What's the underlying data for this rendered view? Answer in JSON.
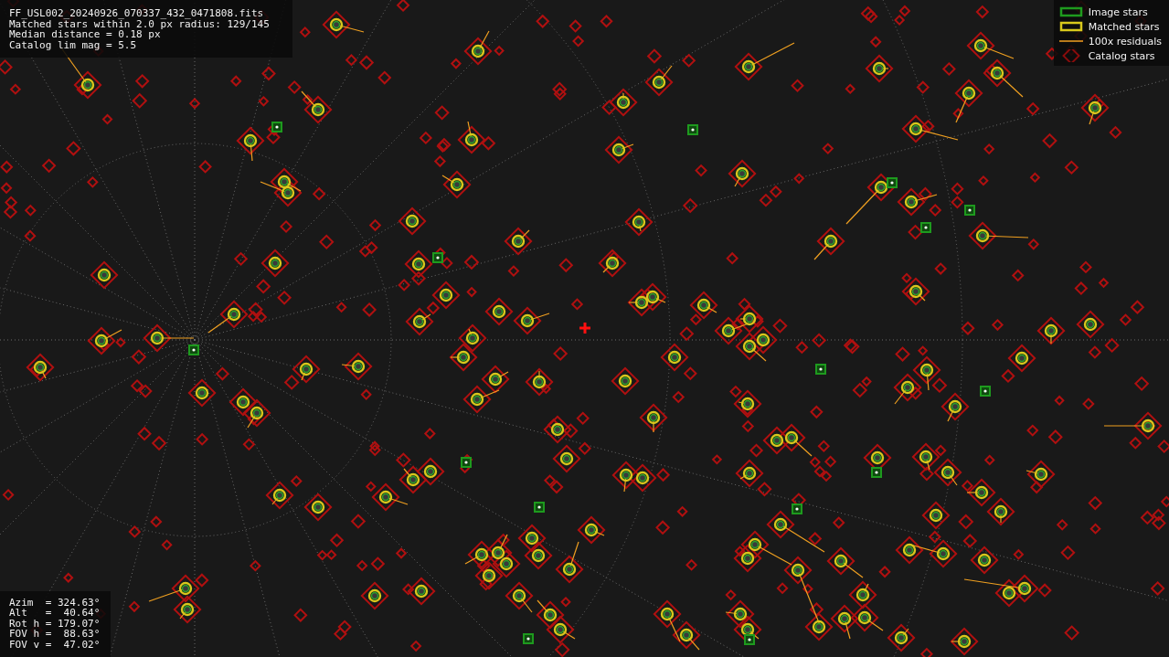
{
  "info": {
    "lines": [
      "FF_USL002_20240926_070337_432_0471808.fits",
      "Matched stars within 2.0 px radius: 129/145",
      "Median distance = 0.18 px",
      "Catalog lim mag = 5.5"
    ]
  },
  "legend": {
    "items": [
      {
        "kind": "image",
        "label": "Image stars"
      },
      {
        "kind": "matched",
        "label": "Matched stars"
      },
      {
        "kind": "residual",
        "label": "100x residuals"
      },
      {
        "kind": "catalog",
        "label": "Catalog stars"
      }
    ]
  },
  "pointing": {
    "lines": [
      "Azim  = 324.63°",
      "Alt   =  40.64°",
      "Rot h = 179.07°",
      "FOV h =  88.63°",
      "FOV v =  47.02°"
    ]
  }
}
